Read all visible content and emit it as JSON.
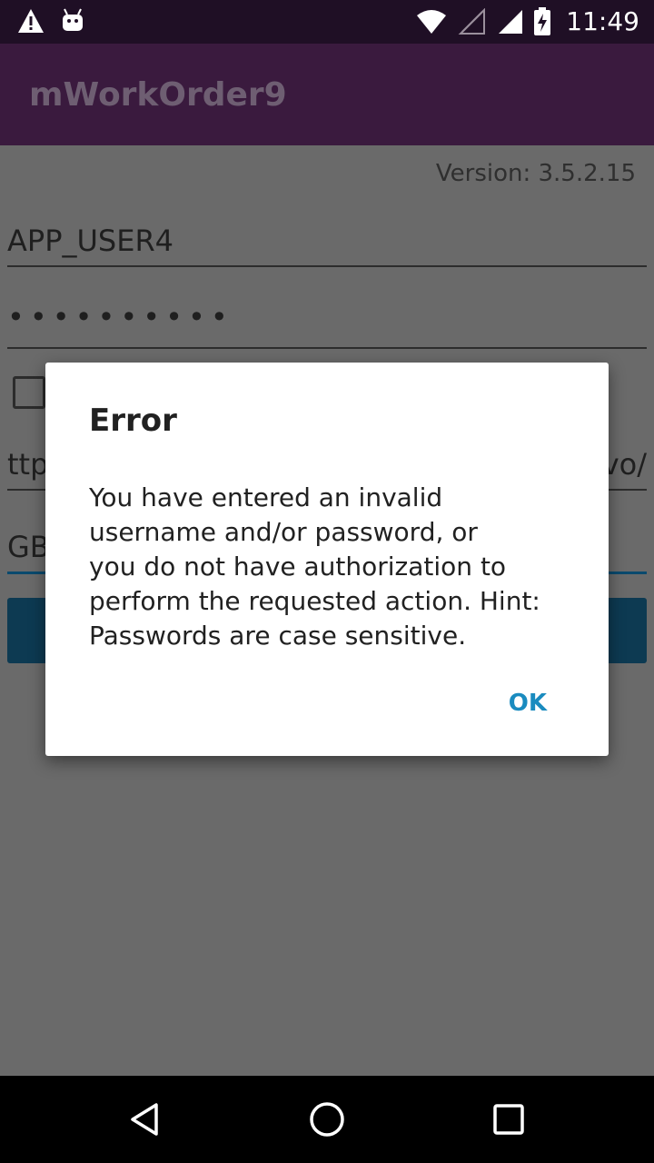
{
  "status_bar": {
    "time": "11:49",
    "icons": [
      "warning-icon",
      "android-icon",
      "wifi-icon",
      "signal-empty-icon",
      "signal-icon",
      "battery-charging-icon"
    ]
  },
  "app_bar": {
    "title": "mWorkOrder9"
  },
  "login_form": {
    "version": "Version: 3.5.2.15",
    "username": "APP_USER4",
    "password_masked": "••••••••••",
    "url_prefix": "ttp",
    "url_suffix": "vo/",
    "site_prefix": "GB"
  },
  "dialog": {
    "title": "Error",
    "message": "You have entered an invalid\nusername and/or password, or\nyou do not have authorization to\nperform the requested action.  Hint:\nPasswords are case sensitive.",
    "ok_label": "OK"
  },
  "nav_bar": {
    "buttons": [
      "back-icon",
      "home-icon",
      "recents-icon"
    ]
  }
}
